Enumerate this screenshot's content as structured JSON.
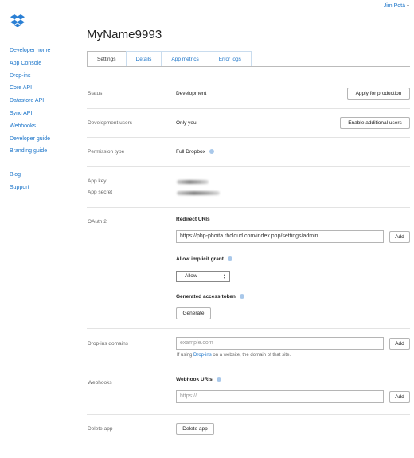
{
  "user": {
    "name": "Jim Potá",
    "caret": "▾"
  },
  "sidebar": {
    "items": [
      "Developer home",
      "App Console",
      "Drop-ins",
      "Core API",
      "Datastore API",
      "Sync API",
      "Webhooks",
      "Developer guide",
      "Branding guide"
    ],
    "secondary": [
      "Blog",
      "Support"
    ]
  },
  "app": {
    "title": "MyName9993",
    "tabs": [
      "Settings",
      "Details",
      "App metrics",
      "Error logs"
    ],
    "active_tab": "Settings"
  },
  "settings": {
    "status": {
      "label": "Status",
      "value": "Development",
      "button": "Apply for production"
    },
    "dev_users": {
      "label": "Development users",
      "value": "Only you",
      "button": "Enable additional users"
    },
    "permission": {
      "label": "Permission type",
      "value": "Full Dropbox"
    },
    "keys": {
      "key_label": "App key",
      "secret_label": "App secret"
    },
    "oauth": {
      "label": "OAuth 2",
      "redirect_title": "Redirect URIs",
      "redirect_value": "https://php-phoita.rhcloud.com/index.php/settings/admin",
      "add": "Add",
      "implicit_title": "Allow implicit grant",
      "implicit_value": "Allow",
      "token_title": "Generated access token",
      "generate": "Generate"
    },
    "dropins": {
      "label": "Drop-ins domains",
      "placeholder": "example.com",
      "add": "Add",
      "hint_before": "If using ",
      "hint_link": "Drop-ins",
      "hint_after": " on a website, the domain of that site."
    },
    "webhooks": {
      "label": "Webhooks",
      "title": "Webhook URIs",
      "placeholder": "https://",
      "add": "Add"
    },
    "delete": {
      "label": "Delete app",
      "button": "Delete app"
    }
  },
  "colors": {
    "link": "#1a74c9",
    "info_icon": "#a9c8ea",
    "logo": "#2a7fd4"
  }
}
